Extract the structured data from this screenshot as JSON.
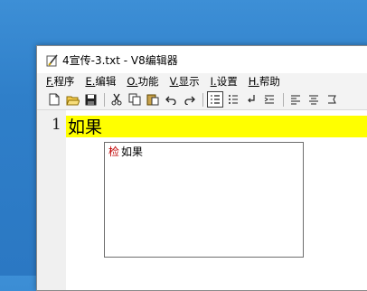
{
  "window": {
    "title": "4宣传-3.txt - V8编辑器"
  },
  "menu": [
    {
      "acc": "F.",
      "label": "程序"
    },
    {
      "acc": "E.",
      "label": "编辑"
    },
    {
      "acc": "O.",
      "label": "功能"
    },
    {
      "acc": "V.",
      "label": "显示"
    },
    {
      "acc": "I.",
      "label": "设置"
    },
    {
      "acc": "H.",
      "label": "帮助"
    }
  ],
  "editor": {
    "line_number": "1",
    "line_text": "如果",
    "highlight_color": "#ffff00"
  },
  "suggestion": {
    "key": "检",
    "word": "如果"
  },
  "icons": [
    "new-file-icon",
    "open-folder-icon",
    "save-icon",
    "cut-icon",
    "copy-icon",
    "paste-icon",
    "undo-icon",
    "redo-icon",
    "line-numbers-icon",
    "list-icon",
    "newline-icon",
    "indent-icon",
    "align-left-icon",
    "align-center-icon",
    "clip-icon"
  ]
}
